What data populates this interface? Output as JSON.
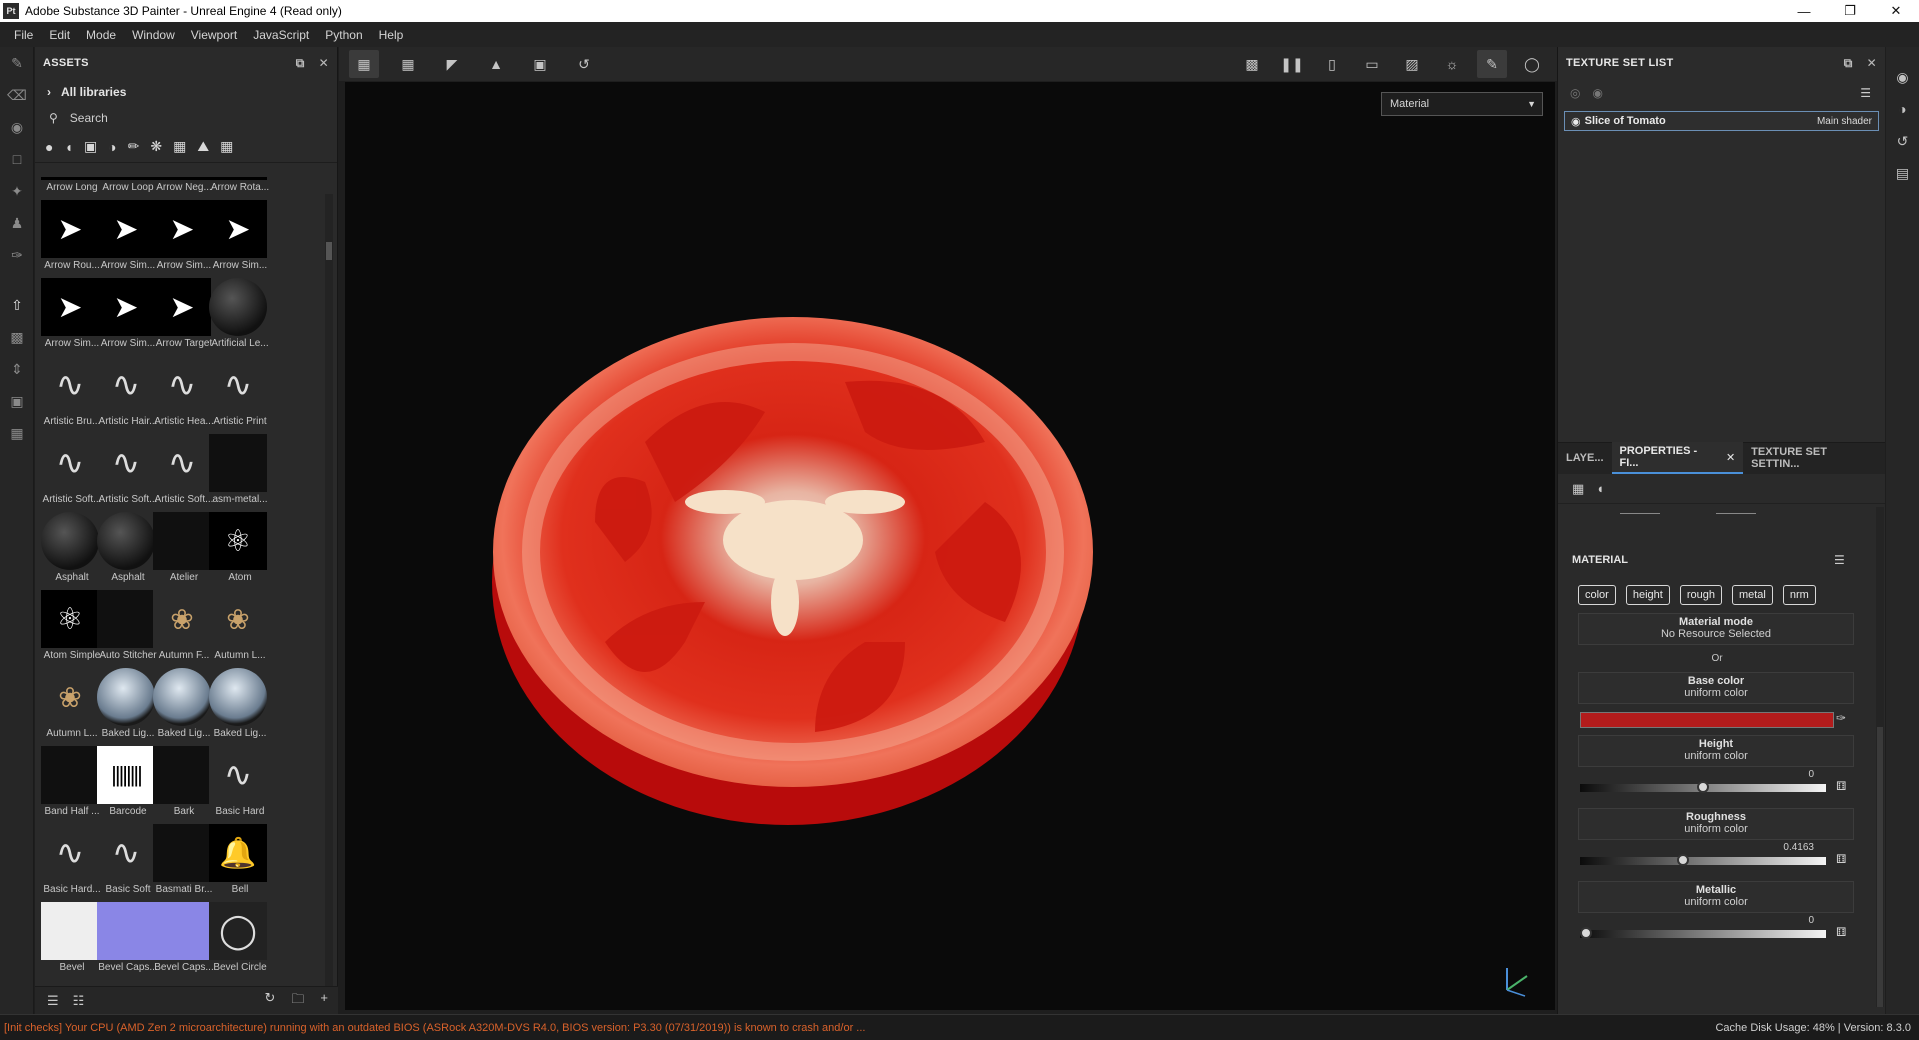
{
  "window": {
    "title": "Adobe Substance 3D Painter - Unreal Engine 4 (Read only)",
    "app_icon": "Pt"
  },
  "menu": [
    "File",
    "Edit",
    "Mode",
    "Window",
    "Viewport",
    "JavaScript",
    "Python",
    "Help"
  ],
  "assets": {
    "title": "ASSETS",
    "library": "All libraries",
    "search_placeholder": "Search",
    "items": [
      "Arrow Long",
      "Arrow Loop",
      "Arrow Neg...",
      "Arrow Rota...",
      "Arrow Rou...",
      "Arrow Sim...",
      "Arrow Sim...",
      "Arrow Sim...",
      "Arrow Sim...",
      "Arrow Sim...",
      "Arrow Target",
      "Artificial Le...",
      "Artistic Bru...",
      "Artistic Hair...",
      "Artistic Hea...",
      "Artistic Print",
      "Artistic Soft...",
      "Artistic Soft...",
      "Artistic Soft...",
      "asm-metal...",
      "Asphalt",
      "Asphalt",
      "Atelier",
      "Atom",
      "Atom Simple",
      "Auto Stitcher",
      "Autumn F...",
      "Autumn L...",
      "Autumn L...",
      "Baked Lig...",
      "Baked Lig...",
      "Baked Lig...",
      "Band Half ...",
      "Barcode",
      "Bark",
      "Basic Hard",
      "Basic Hard...",
      "Basic Soft",
      "Basmati Br...",
      "Bell",
      "Bevel",
      "Bevel Caps...",
      "Bevel Caps...",
      "Bevel Circle"
    ]
  },
  "viewport": {
    "mode_select": "Material"
  },
  "texture_set_list": {
    "title": "TEXTURE SET LIST",
    "entry_name": "Slice of Tomato",
    "entry_shader": "Main shader"
  },
  "tabs": {
    "layers": "LAYE...",
    "properties": "PROPERTIES - FI...",
    "texture_set_settings": "TEXTURE SET SETTIN..."
  },
  "properties": {
    "section": "MATERIAL",
    "channels": [
      "color",
      "height",
      "rough",
      "metal",
      "nrm"
    ],
    "material_mode": {
      "title": "Material mode",
      "value": "No Resource Selected"
    },
    "or_label": "Or",
    "base_color": {
      "title": "Base color",
      "value": "uniform color",
      "color": "#b31c1c"
    },
    "height": {
      "title": "Height",
      "value": "uniform color",
      "number": "0",
      "level": 0.5
    },
    "roughness": {
      "title": "Roughness",
      "value": "uniform color",
      "number": "0.4163",
      "level": 0.4163
    },
    "metallic": {
      "title": "Metallic",
      "value": "uniform color",
      "number": "0",
      "level": 0
    }
  },
  "status": {
    "warning": "[Init checks] Your CPU (AMD Zen 2 microarchitecture) running with an outdated BIOS (ASRock A320M-DVS R4.0, BIOS version: P3.30 (07/31/2019)) is known to crash and/or ...",
    "cache": "Cache Disk Usage:",
    "cache_pct": "48%",
    "version": "Version: 8.3.0"
  }
}
